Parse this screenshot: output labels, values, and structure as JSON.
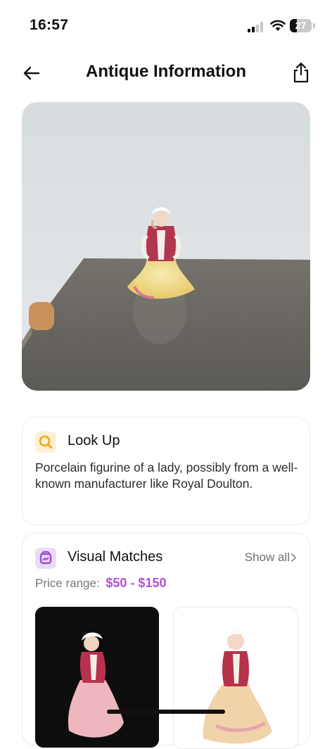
{
  "status_bar": {
    "time": "16:57",
    "battery": "27"
  },
  "nav": {
    "title": "Antique Information"
  },
  "lookup": {
    "title": "Look Up",
    "description": "Porcelain figurine of a lady, possibly from a well-known manufacturer like Royal Doulton."
  },
  "matches": {
    "title": "Visual Matches",
    "show_all": "Show all",
    "price_label": "Price range:",
    "price_value": "$50 - $150"
  },
  "colors": {
    "accent_purple": "#b14fd8",
    "lookup_icon": "#f2a51a",
    "match_icon": "#9b4bd6"
  },
  "icons": [
    "back-arrow-icon",
    "share-icon",
    "search-icon",
    "visual-match-icon",
    "chevron-right-icon",
    "wifi-icon",
    "signal-icon",
    "battery-icon"
  ]
}
